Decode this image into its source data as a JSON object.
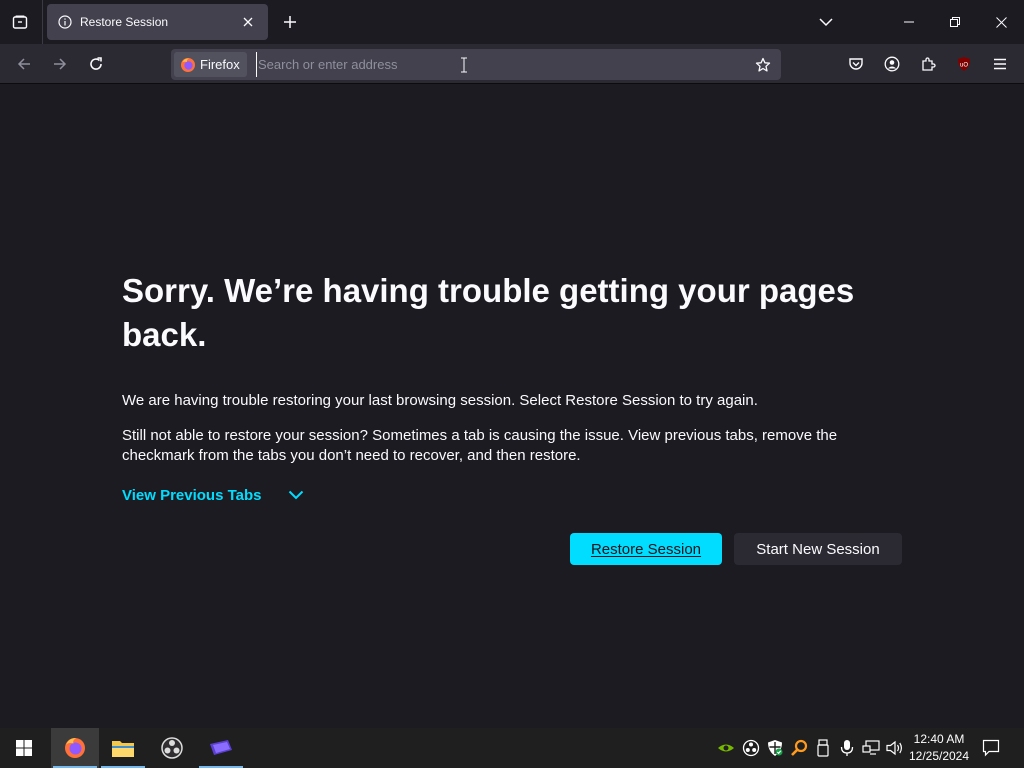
{
  "browser": {
    "tab_title": "Restore Session",
    "identity_label": "Firefox",
    "url_placeholder": "Search or enter address",
    "url_value": ""
  },
  "page": {
    "heading": "Sorry. We’re having trouble getting your pages back.",
    "paragraph1": "We are having trouble restoring your last browsing session. Select Restore Session to try again.",
    "paragraph2": "Still not able to restore your session? Sometimes a tab is causing the issue. View previous tabs, remove the checkmark from the tabs you don’t need to recover, and then restore.",
    "view_previous_tabs": "View Previous Tabs",
    "restore_button": "Restore Session",
    "new_session_button": "Start New Session"
  },
  "taskbar": {
    "apps": [
      "firefox-icon",
      "file-explorer-icon",
      "obs-icon",
      "game-app-icon"
    ],
    "tray_icons": [
      "nvidia-icon",
      "obs-tray-icon",
      "security-shield-icon",
      "search-tool-icon",
      "usb-icon",
      "microphone-icon",
      "network-icon",
      "volume-icon"
    ],
    "time": "12:40 AM",
    "date": "12/25/2024"
  },
  "colors": {
    "accent": "#00ddff",
    "background": "#1c1b22",
    "toolbar": "#2b2a33"
  }
}
